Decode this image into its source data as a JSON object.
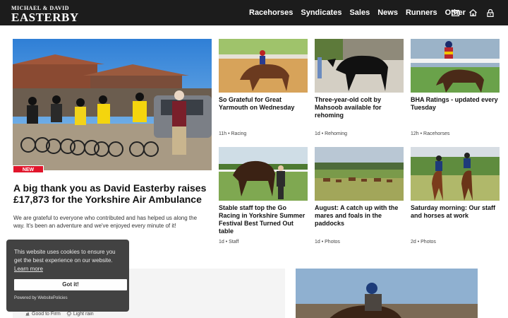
{
  "header": {
    "logo_small": "MICHAEL & DAVID",
    "logo_big": "EASTERBY",
    "nav": [
      "Racehorses",
      "Syndicates",
      "Sales",
      "News",
      "Runners",
      "Other"
    ],
    "icons": [
      "mail-icon",
      "home-icon",
      "lock-icon"
    ]
  },
  "hero": {
    "badge": "NEW",
    "title": "A big thank you as David Easterby raises £17,873 for the Yorkshire Air Ambulance",
    "text": "We are grateful to everyone who contributed and has helped us along the way. It's been an adventure and we've enjoyed every minute of it!"
  },
  "cards": [
    {
      "title": "So Grateful for Great Yarmouth on Wednesday",
      "meta": "11h • Racing"
    },
    {
      "title": "Three-year-old colt by Mahsoob available for rehoming",
      "meta": "1d • Rehoming"
    },
    {
      "title": "BHA Ratings - updated every Tuesday",
      "meta": "12h • Racehorses"
    },
    {
      "title": "Stable staff top the Go Racing in Yorkshire Summer Festival Best Turned Out table",
      "meta": "1d • Staff"
    },
    {
      "title": "August: A catch up with the mares and foals in the paddocks",
      "meta": "1d • Photos"
    },
    {
      "title": "Saturday morning: Our staff and horses at work",
      "meta": "2d • Photos"
    }
  ],
  "weather": {
    "going": "Good to Firm",
    "conditions": "Light rain"
  },
  "cookie": {
    "text": "This website uses cookies to ensure you get the best experience on our website.",
    "learn_more": "Learn more",
    "button": "Got it!",
    "powered": "Powered by WebsitePolicies"
  },
  "colors": {
    "header_bg": "#1c1c1c",
    "badge_red": "#e1152b",
    "cookie_bg": "#3b3b3b"
  }
}
